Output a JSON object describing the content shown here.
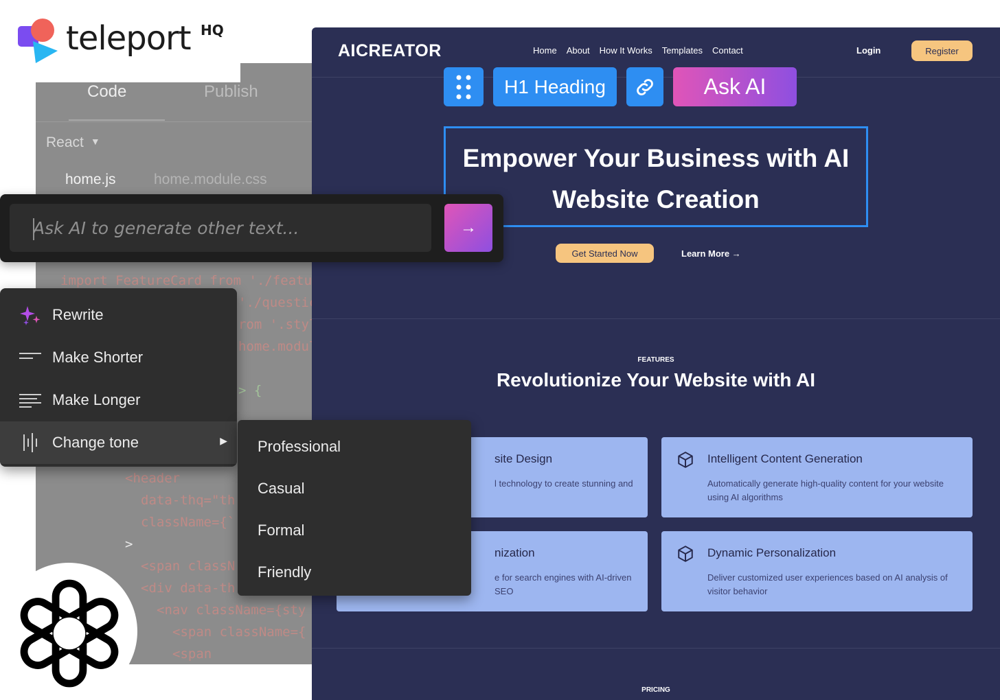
{
  "branding": {
    "name": "teleport",
    "suffix": "HQ"
  },
  "editor": {
    "tabs": [
      "Code",
      "Publish"
    ],
    "framework": "React",
    "files": [
      "home.js",
      "home.module.css"
    ],
    "code_lines": [
      "import FeatureCard from './featu",
      "'./questic",
      "rom '.styl",
      "home.modul",
      "> {",
      "<header",
      "data-thq=\"th",
      "className={`",
      ">",
      "<span classN",
      "<div data-th",
      "<nav className={sty",
      "<span className={",
      "<span"
    ]
  },
  "ask_ai": {
    "placeholder": "Ask AI to generate other text...",
    "send_label": "→"
  },
  "context_menu": {
    "items": [
      {
        "label": "Rewrite",
        "icon": "sparkles-icon"
      },
      {
        "label": "Make Shorter",
        "icon": "short-lines-icon"
      },
      {
        "label": "Make Longer",
        "icon": "long-lines-icon"
      },
      {
        "label": "Change tone",
        "icon": "waveform-icon",
        "arrow": "▶"
      }
    ],
    "tone_options": [
      "Professional",
      "Casual",
      "Formal",
      "Friendly"
    ]
  },
  "site": {
    "brand": "AICREATOR",
    "nav": [
      "Home",
      "About",
      "How It Works",
      "Templates",
      "Contact"
    ],
    "login": "Login",
    "register": "Register",
    "toolbar": {
      "heading_label": "H1 Heading",
      "ask_ai_label": "Ask AI"
    },
    "hero": {
      "title_line1": "Empower Your Business with AI",
      "title_line2": "Website Creation",
      "cta_primary": "Get Started Now",
      "cta_secondary": "Learn More →"
    },
    "features": {
      "label": "FEATURES",
      "title": "Revolutionize Your Website with AI",
      "cards": [
        {
          "title": "site Design",
          "desc": "l technology to create stunning and"
        },
        {
          "title": "Intelligent Content Generation",
          "desc": "Automatically generate high-quality content for your website using AI algorithms"
        },
        {
          "title": "nization",
          "desc": "e for search engines with AI-driven SEO"
        },
        {
          "title": "Dynamic Personalization",
          "desc": "Deliver customized user experiences based on AI analysis of visitor behavior"
        }
      ]
    },
    "pricing_label": "PRICING"
  },
  "colors": {
    "site_bg": "#2b2f54",
    "accent_blue": "#2e8ef2",
    "ai_gradient_start": "#e055b8",
    "ai_gradient_end": "#8e4fe0",
    "button_yellow": "#f6c57f",
    "card_bg": "#9db6f0",
    "editor_bg": "#8c8c8c",
    "menu_bg": "#2e2e2e"
  }
}
